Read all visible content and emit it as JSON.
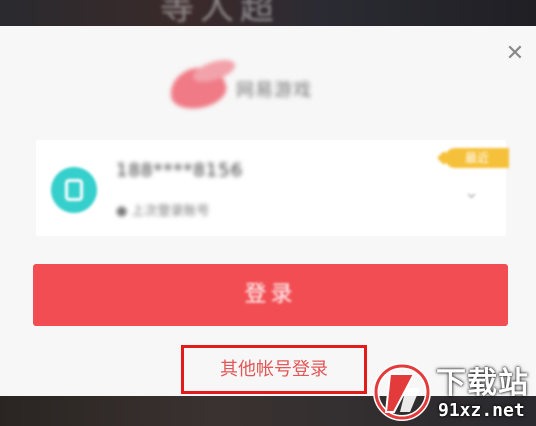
{
  "background": {
    "title_text": "等人超"
  },
  "dialog": {
    "close_icon": "close-icon",
    "logo_text": "网易游戏",
    "account": {
      "name": "188****8156",
      "subtitle": "● 上次登录账号",
      "badge": "最近"
    },
    "login_button": "登录",
    "other_account_link": "其他帐号登录"
  },
  "watermark": {
    "line1": "下载站",
    "line2": "91xz.net"
  },
  "colors": {
    "accent_red": "#f24d53",
    "highlight_box": "#e31b1b",
    "avatar_teal": "#35cfcc",
    "badge_yellow": "#f6c13a"
  }
}
